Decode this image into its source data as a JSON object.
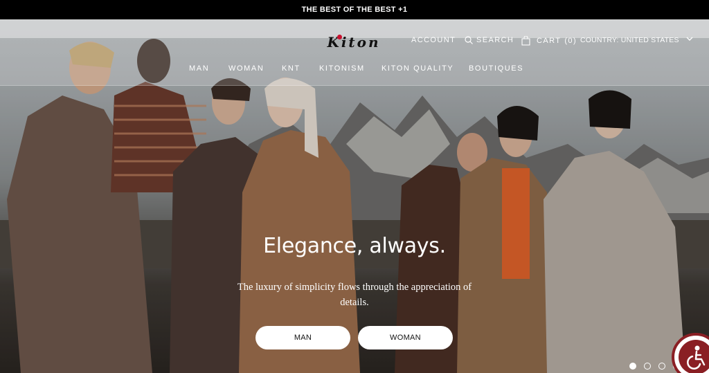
{
  "promo": {
    "text": "THE BEST OF THE BEST +1"
  },
  "brand": {
    "logo": "Kiton",
    "accent": "#c8102e"
  },
  "header": {
    "account": "ACCOUNT",
    "search": "SEARCH",
    "cart": "CART",
    "cart_count": "(0)",
    "country": "COUNTRY: UNITED STATES"
  },
  "nav": {
    "items": [
      "MAN",
      "WOMAN",
      "KNT",
      "KITONISM",
      "KITON QUALITY",
      "BOUTIQUES"
    ]
  },
  "hero": {
    "title": "Elegance, always.",
    "subtitle": "The luxury of simplicity flows through the appreciation of details.",
    "cta_man": "MAN",
    "cta_woman": "WOMAN"
  },
  "carousel": {
    "slides": 4,
    "active": 1
  },
  "icons": {
    "search": "search-icon",
    "cart": "shopping-bag-icon",
    "country": "chevron-down-icon",
    "accessibility": "accessibility-icon"
  }
}
